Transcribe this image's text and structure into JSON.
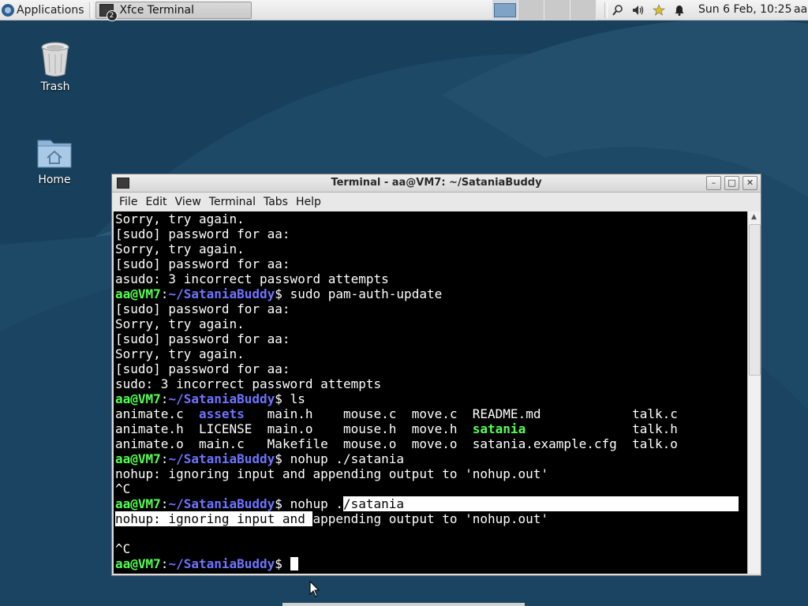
{
  "panel": {
    "applications_label": "Applications",
    "task_label": "Xfce Terminal",
    "task_badge": "2",
    "clock": "Sun  6 Feb, 10:25",
    "user": "aa",
    "workspace_count": 4
  },
  "desktop": {
    "icons": [
      {
        "label": "Trash",
        "icon": "trash-icon"
      },
      {
        "label": "Home",
        "icon": "home-folder-icon"
      }
    ]
  },
  "window": {
    "title": "Terminal - aa@VM7: ~/SataniaBuddy",
    "menu": [
      "File",
      "Edit",
      "View",
      "Terminal",
      "Tabs",
      "Help"
    ]
  },
  "terminal": {
    "prompt_user": "aa@VM7",
    "prompt_sep": ":",
    "prompt_path": "~/SataniaBuddy",
    "prompt_end": "$ ",
    "lines": [
      {
        "type": "text",
        "text": "Sorry, try again."
      },
      {
        "type": "text",
        "text": "[sudo] password for aa:"
      },
      {
        "type": "text",
        "text": "Sorry, try again."
      },
      {
        "type": "text",
        "text": "[sudo] password for aa:"
      },
      {
        "type": "text",
        "text": "asudo: 3 incorrect password attempts"
      },
      {
        "type": "prompt",
        "cmd": "sudo pam-auth-update"
      },
      {
        "type": "text",
        "text": "[sudo] password for aa:"
      },
      {
        "type": "text",
        "text": "Sorry, try again."
      },
      {
        "type": "text",
        "text": "[sudo] password for aa:"
      },
      {
        "type": "text",
        "text": "Sorry, try again."
      },
      {
        "type": "text",
        "text": "[sudo] password for aa:"
      },
      {
        "type": "text",
        "text": "sudo: 3 incorrect password attempts"
      },
      {
        "type": "prompt",
        "cmd": "ls"
      },
      {
        "type": "ls",
        "cells": [
          {
            "t": "animate.c",
            "w": 11
          },
          {
            "t": "assets",
            "w": 9,
            "c": "dir"
          },
          {
            "t": "main.h",
            "w": 10
          },
          {
            "t": "mouse.c",
            "w": 9
          },
          {
            "t": "move.c",
            "w": 8
          },
          {
            "t": "README.md",
            "w": 21
          },
          {
            "t": "talk.c",
            "w": 0
          }
        ]
      },
      {
        "type": "ls",
        "cells": [
          {
            "t": "animate.h",
            "w": 11
          },
          {
            "t": "LICENSE",
            "w": 9
          },
          {
            "t": "main.o",
            "w": 10
          },
          {
            "t": "mouse.h",
            "w": 9
          },
          {
            "t": "move.h",
            "w": 8
          },
          {
            "t": "satania",
            "w": 21,
            "c": "exe"
          },
          {
            "t": "talk.h",
            "w": 0
          }
        ]
      },
      {
        "type": "ls",
        "cells": [
          {
            "t": "animate.o",
            "w": 11
          },
          {
            "t": "main.c",
            "w": 9
          },
          {
            "t": "Makefile",
            "w": 10
          },
          {
            "t": "mouse.o",
            "w": 9
          },
          {
            "t": "move.o",
            "w": 8
          },
          {
            "t": "satania.example.cfg",
            "w": 21
          },
          {
            "t": "talk.o",
            "w": 0
          }
        ]
      },
      {
        "type": "prompt",
        "cmd": "nohup ./satania"
      },
      {
        "type": "text",
        "text": "nohup: ignoring input and appending output to 'nohup.out'"
      },
      {
        "type": "text",
        "text": "^C"
      },
      {
        "type": "prompt_sel",
        "cmd_plain": "nohup .",
        "cmd_sel": "/satania"
      },
      {
        "type": "text_sel",
        "sel": "nohup: ignoring input and ",
        "rest": "appending output to 'nohup.out'"
      },
      {
        "type": "text",
        "text": ""
      },
      {
        "type": "text",
        "text": "^C"
      },
      {
        "type": "prompt_cursor",
        "cmd": ""
      }
    ]
  }
}
